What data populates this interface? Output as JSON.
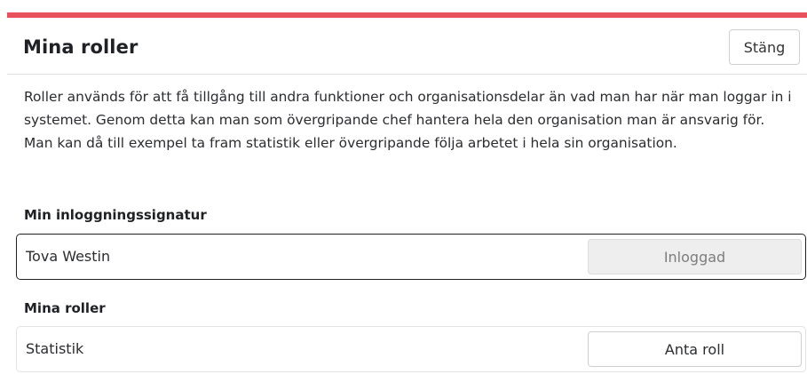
{
  "modal": {
    "title": "Mina roller",
    "close_label": "Stäng",
    "accent_color": "#e8505b",
    "description": "Roller används för att få tillgång till andra funktioner och organisationsdelar än vad man har när man loggar in i systemet. Genom detta kan man som övergripande chef hantera hela den organisation man är ansvarig för. Man kan då till exempel ta fram statistik eller övergripande följa arbetet i hela sin organisation."
  },
  "signature": {
    "heading": "Min inloggningssignatur",
    "name": "Tova Westin",
    "status_label": "Inloggad"
  },
  "roles": {
    "heading": "Mina roller",
    "items": [
      {
        "label": "Statistik",
        "action_label": "Anta roll"
      }
    ]
  }
}
